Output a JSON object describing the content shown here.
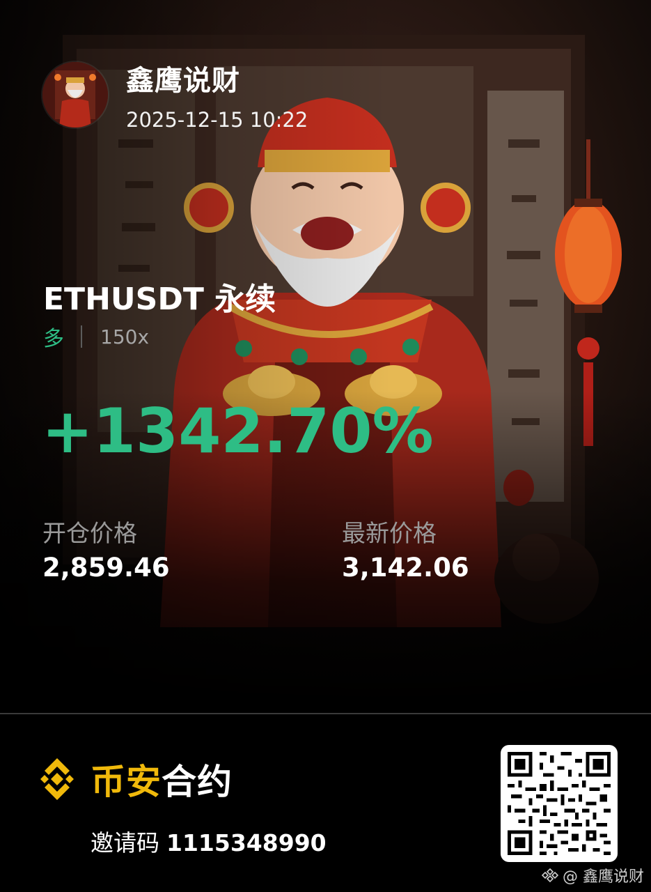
{
  "author": {
    "name": "鑫鹰说财",
    "timestamp": "2025-12-15 10:22",
    "avatar_icon": "god-of-wealth-avatar"
  },
  "position": {
    "symbol": "ETHUSDT 永续",
    "side": "多",
    "leverage": "150x",
    "pnl_percent": "+1342.70%",
    "entry_price_label": "开仓价格",
    "entry_price": "2,859.46",
    "last_price_label": "最新价格",
    "last_price": "3,142.06"
  },
  "footer": {
    "brand_yellow": "币安",
    "brand_white": "合约",
    "brand_icon": "binance-logo-icon",
    "invite_label": "邀请码",
    "invite_code": "1115348990",
    "qr_icon": "qr-code",
    "watermark": "@ 鑫鹰说财"
  },
  "colors": {
    "profit_green": "#2ebd85",
    "binance_yellow": "#f0b90b",
    "label_gray": "#9a9a9a"
  }
}
